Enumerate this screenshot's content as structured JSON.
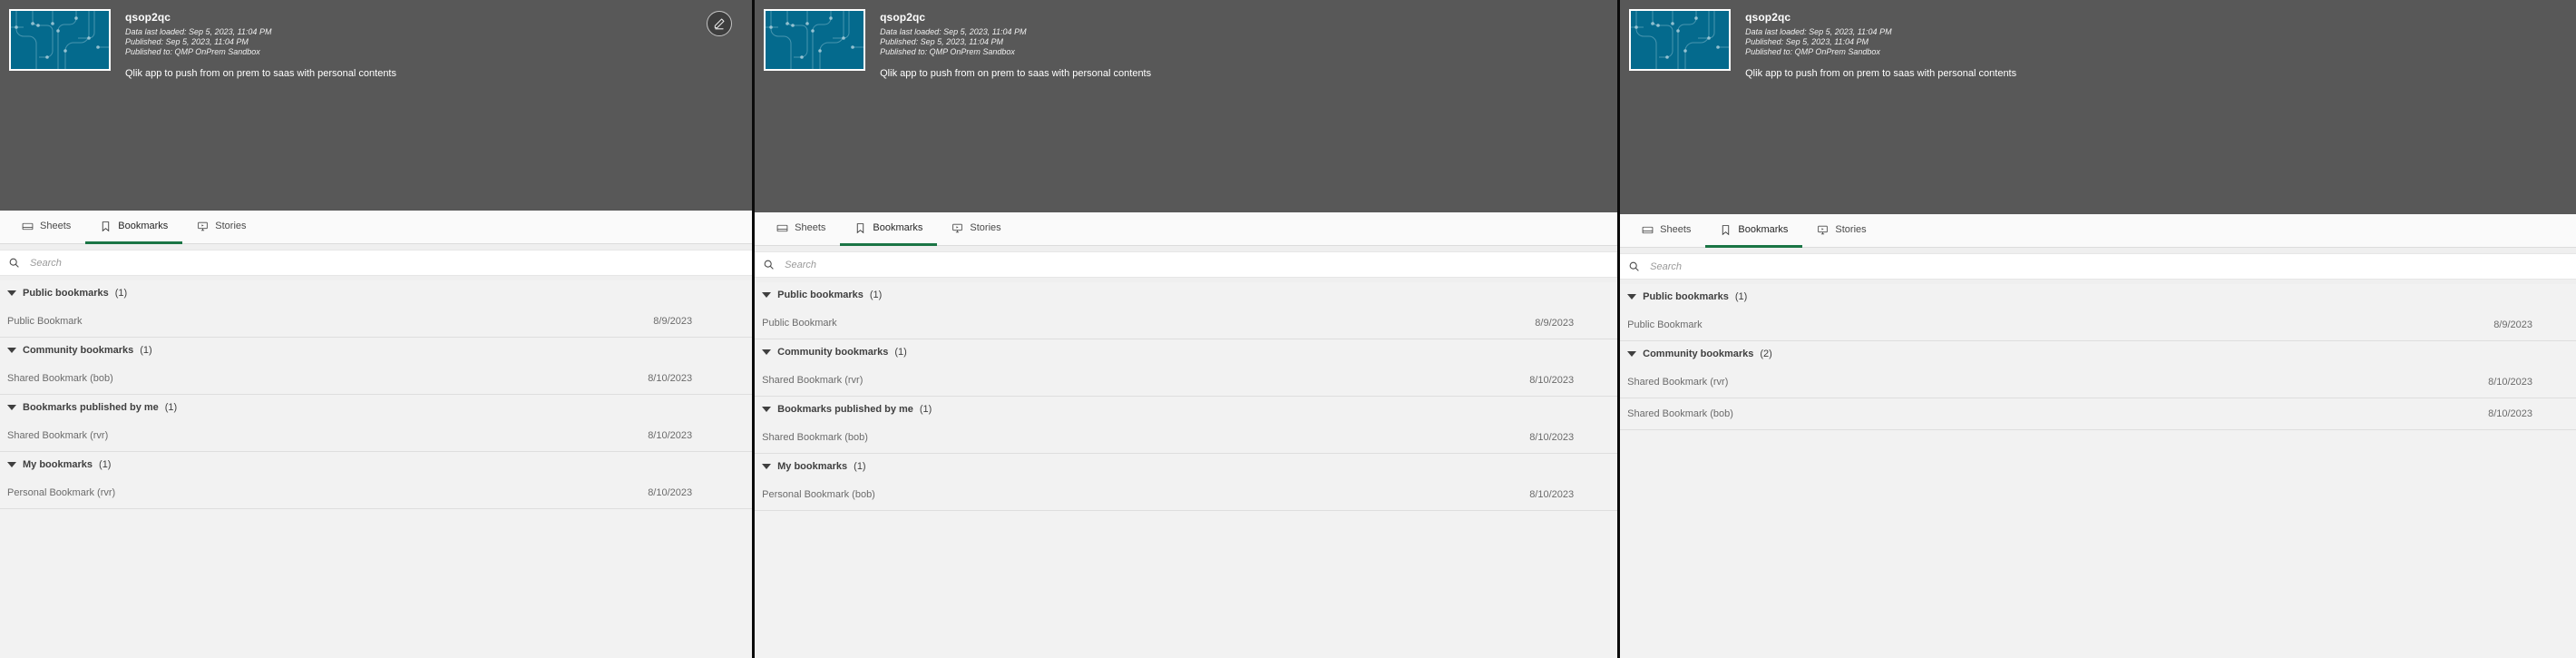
{
  "app": {
    "title": "qsop2qc",
    "data_last_loaded": "Data last loaded: Sep 5, 2023, 11:04 PM",
    "published": "Published: Sep 5, 2023, 11:04 PM",
    "published_to": "Published to: QMP OnPrem Sandbox",
    "description": "Qlik app to push from on prem to saas with personal contents",
    "thumbnail_color": "#046a8d",
    "accent_color": "#1a7545",
    "header_color": "#585858"
  },
  "tabs": [
    {
      "label": "Sheets",
      "icon": "sheets-icon",
      "active": false
    },
    {
      "label": "Bookmarks",
      "icon": "bookmark-icon",
      "active": true
    },
    {
      "label": "Stories",
      "icon": "story-icon",
      "active": false
    }
  ],
  "search": {
    "placeholder": "Search",
    "value": "",
    "icon": "search-icon"
  },
  "panels": [
    {
      "id": "panel-1",
      "has_edit_button": true,
      "edit_button_icon": "pencil-icon",
      "groups": [
        {
          "label": "Public bookmarks",
          "count": "(1)",
          "rows": [
            {
              "name": "Public Bookmark",
              "date": "8/9/2023"
            }
          ]
        },
        {
          "label": "Community bookmarks",
          "count": "(1)",
          "rows": [
            {
              "name": "Shared Bookmark (bob)",
              "date": "8/10/2023"
            }
          ]
        },
        {
          "label": "Bookmarks published by me",
          "count": "(1)",
          "rows": [
            {
              "name": "Shared Bookmark (rvr)",
              "date": "8/10/2023"
            }
          ]
        },
        {
          "label": "My bookmarks",
          "count": "(1)",
          "rows": [
            {
              "name": "Personal Bookmark (rvr)",
              "date": "8/10/2023"
            }
          ]
        }
      ]
    },
    {
      "id": "panel-2",
      "has_edit_button": false,
      "groups": [
        {
          "label": "Public bookmarks",
          "count": "(1)",
          "rows": [
            {
              "name": "Public Bookmark",
              "date": "8/9/2023"
            }
          ]
        },
        {
          "label": "Community bookmarks",
          "count": "(1)",
          "rows": [
            {
              "name": "Shared Bookmark (rvr)",
              "date": "8/10/2023"
            }
          ]
        },
        {
          "label": "Bookmarks published by me",
          "count": "(1)",
          "rows": [
            {
              "name": "Shared Bookmark (bob)",
              "date": "8/10/2023"
            }
          ]
        },
        {
          "label": "My bookmarks",
          "count": "(1)",
          "rows": [
            {
              "name": "Personal Bookmark (bob)",
              "date": "8/10/2023"
            }
          ]
        }
      ]
    },
    {
      "id": "panel-3",
      "has_edit_button": false,
      "groups": [
        {
          "label": "Public bookmarks",
          "count": "(1)",
          "rows": [
            {
              "name": "Public Bookmark",
              "date": "8/9/2023"
            }
          ]
        },
        {
          "label": "Community bookmarks",
          "count": "(2)",
          "rows": [
            {
              "name": "Shared Bookmark (rvr)",
              "date": "8/10/2023"
            },
            {
              "name": "Shared Bookmark (bob)",
              "date": "8/10/2023"
            }
          ]
        }
      ]
    }
  ]
}
